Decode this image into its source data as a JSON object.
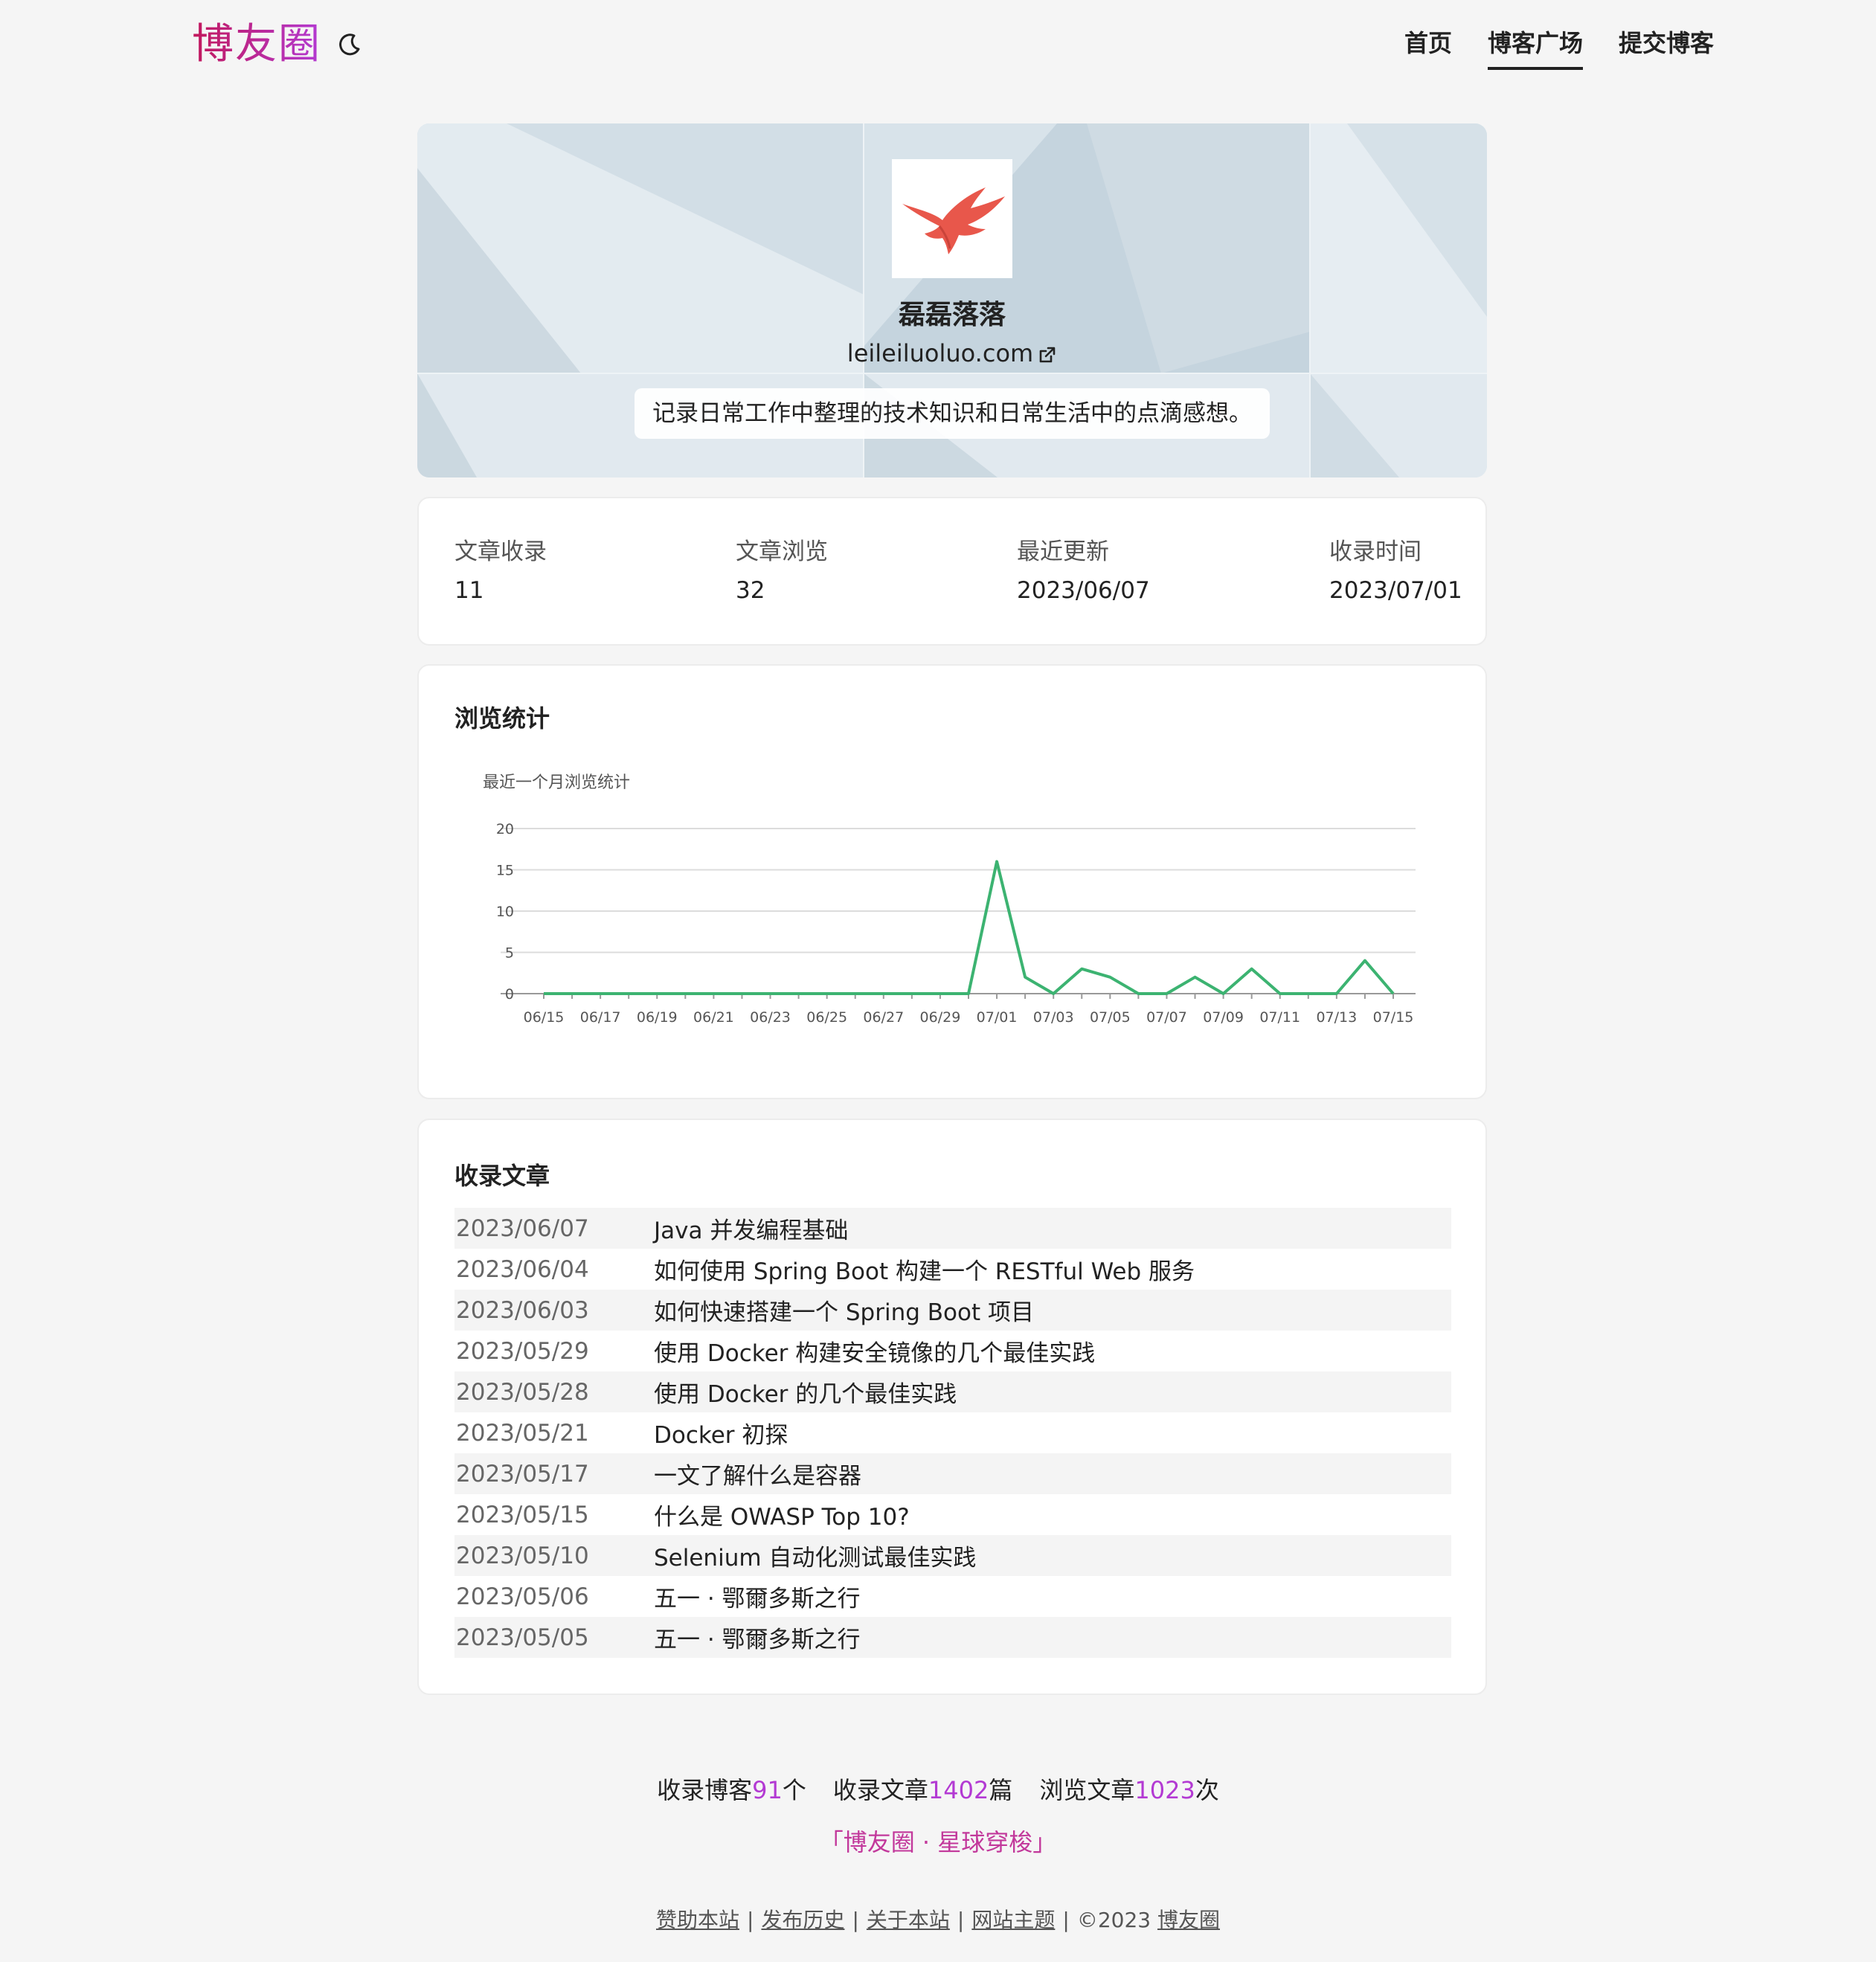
{
  "header": {
    "logo": "博友圈",
    "nav": [
      "首页",
      "博客广场",
      "提交博客"
    ],
    "active_nav": "博客广场"
  },
  "profile": {
    "name": "磊磊落落",
    "url": "leileiluoluo.com",
    "description": "记录日常工作中整理的技术知识和日常生活中的点滴感想。"
  },
  "stats": {
    "items": [
      {
        "label": "文章收录",
        "value": "11"
      },
      {
        "label": "文章浏览",
        "value": "32"
      },
      {
        "label": "最近更新",
        "value": "2023/06/07"
      },
      {
        "label": "收录时间",
        "value": "2023/07/01"
      }
    ]
  },
  "views_section": {
    "title": "浏览统计"
  },
  "chart_data": {
    "type": "line",
    "title": "最近一个月浏览统计",
    "x": [
      "06/15",
      "06/16",
      "06/17",
      "06/18",
      "06/19",
      "06/20",
      "06/21",
      "06/22",
      "06/23",
      "06/24",
      "06/25",
      "06/26",
      "06/27",
      "06/28",
      "06/29",
      "06/30",
      "07/01",
      "07/02",
      "07/03",
      "07/04",
      "07/05",
      "07/06",
      "07/07",
      "07/08",
      "07/09",
      "07/10",
      "07/11",
      "07/12",
      "07/13",
      "07/14",
      "07/15"
    ],
    "x_tick_labels": [
      "06/15",
      "06/17",
      "06/19",
      "06/21",
      "06/23",
      "06/25",
      "06/27",
      "06/29",
      "07/01",
      "07/03",
      "07/05",
      "07/07",
      "07/09",
      "07/11",
      "07/13",
      "07/15"
    ],
    "series": [
      {
        "values": [
          0,
          0,
          0,
          0,
          0,
          0,
          0,
          0,
          0,
          0,
          0,
          0,
          0,
          0,
          0,
          0,
          16,
          2,
          0,
          3,
          2,
          0,
          0,
          2,
          0,
          3,
          0,
          0,
          0,
          4,
          0
        ]
      }
    ],
    "ylim": [
      0,
      20
    ],
    "yticks": [
      0,
      5,
      10,
      15,
      20
    ],
    "grid": true,
    "line_color": "#3cb371"
  },
  "articles_section": {
    "title": "收录文章",
    "items": [
      {
        "date": "2023/06/07",
        "title": "Java 并发编程基础"
      },
      {
        "date": "2023/06/04",
        "title": "如何使用 Spring Boot 构建一个 RESTful Web 服务"
      },
      {
        "date": "2023/06/03",
        "title": "如何快速搭建一个 Spring Boot 项目"
      },
      {
        "date": "2023/05/29",
        "title": "使用 Docker 构建安全镜像的几个最佳实践"
      },
      {
        "date": "2023/05/28",
        "title": "使用 Docker 的几个最佳实践"
      },
      {
        "date": "2023/05/21",
        "title": "Docker 初探"
      },
      {
        "date": "2023/05/17",
        "title": "一文了解什么是容器"
      },
      {
        "date": "2023/05/15",
        "title": "什么是 OWASP Top 10?"
      },
      {
        "date": "2023/05/10",
        "title": "Selenium 自动化测试最佳实践"
      },
      {
        "date": "2023/05/06",
        "title": "五一 · 鄂爾多斯之行"
      },
      {
        "date": "2023/05/05",
        "title": "五一 · 鄂爾多斯之行"
      }
    ]
  },
  "footer": {
    "blogs_prefix": "收录博客",
    "blogs_count": "91",
    "blogs_suffix": "个",
    "articles_prefix": "收录文章",
    "articles_count": "1402",
    "articles_suffix": "篇",
    "views_prefix": "浏览文章",
    "views_count": "1023",
    "views_suffix": "次",
    "slogan": "「博友圈 · 星球穿梭」",
    "links": [
      "赞助本站",
      "发布历史",
      "关于本站",
      "网站主题"
    ],
    "copyright": "©2023",
    "site_link": "博友圈",
    "accent": "#b33ad3"
  }
}
